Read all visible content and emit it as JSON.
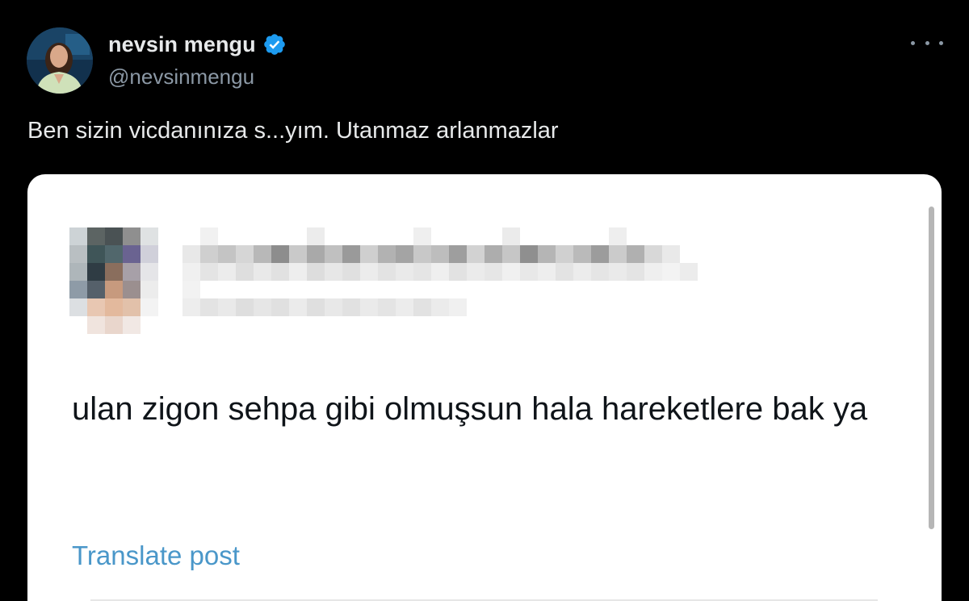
{
  "author": {
    "display_name": "nevsin mengu",
    "handle": "@nevsinmengu",
    "verified": true,
    "avatar_icon": "profile-photo"
  },
  "post": {
    "text": "Ben sizin vicdanınıza s...yım. Utanmaz arlanmazlar",
    "more_icon": "more-horizontal-icon"
  },
  "quoted_post": {
    "text": "ulan zigon sehpa gibi olmuşsun hala hareketlere bak ya",
    "translate_label": "Translate post",
    "author_pixelated": true
  },
  "colors": {
    "background": "#000000",
    "text_primary": "#e7e9ea",
    "text_secondary": "#8b98a5",
    "verified_blue": "#1d9bf0",
    "link_blue": "#4a97c9",
    "card_background": "#ffffff"
  }
}
